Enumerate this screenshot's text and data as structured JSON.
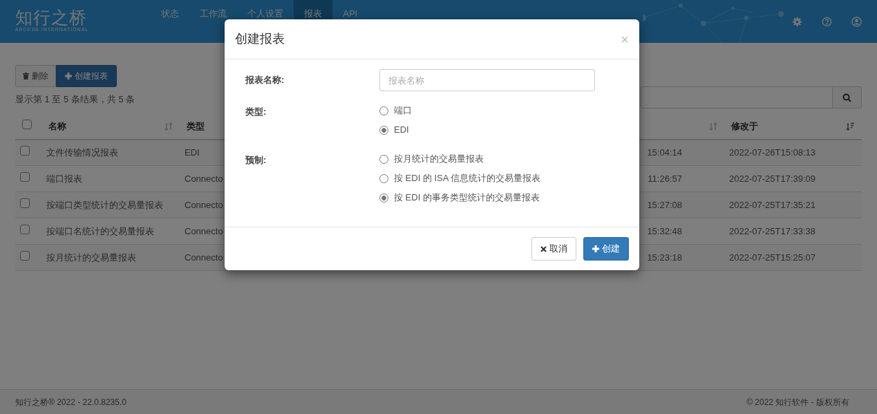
{
  "navbar": {
    "brand": "知行之桥",
    "brand_sub": "ARCESB INTERNATIONAL",
    "items": [
      {
        "label": "状态",
        "selected": false
      },
      {
        "label": "工作流",
        "selected": false
      },
      {
        "label": "个人设置",
        "selected": false
      },
      {
        "label": "报表",
        "selected": true
      },
      {
        "label": "API",
        "selected": false
      }
    ]
  },
  "toolbar": {
    "buttons": [
      {
        "label": "删除",
        "kind": "delete"
      },
      {
        "label": "创建报表",
        "kind": "create"
      }
    ],
    "summary": "显示第 1 至 5 条结果，共 5 条"
  },
  "table": {
    "all_checked": false,
    "columns": [
      {
        "label": "名称",
        "sortable": true,
        "sorted_desc": false
      },
      {
        "label": "类型"
      },
      {
        "sortable": true,
        "sorted_desc": false
      },
      {
        "label": "修改于",
        "sortable": true,
        "sorted_desc": true
      }
    ],
    "rows": [
      {
        "checked": false,
        "cells": [
          "文件传输情况报表",
          "EDI",
          "15:04:14",
          "2022-07-26T15:08:13"
        ]
      },
      {
        "checked": false,
        "cells": [
          "端口报表",
          "Connecto",
          "11:26:57",
          "2022-07-25T17:39:09"
        ]
      },
      {
        "checked": false,
        "cells": [
          "按端口类型统计的交易量报表",
          "Connecto",
          "15:27:08",
          "2022-07-25T17:35:21"
        ]
      },
      {
        "checked": false,
        "cells": [
          "按端口名统计的交易量报表",
          "Connecto",
          "15:32:48",
          "2022-07-25T17:33:38"
        ]
      },
      {
        "checked": false,
        "cells": [
          "按月统计的交易量报表",
          "Connecto",
          "15:23:18",
          "2022-07-25T15:25:07"
        ]
      }
    ]
  },
  "modal": {
    "title": "创建报表",
    "close": "×",
    "fields": [
      {
        "kind": "text",
        "label": "报表名称:",
        "placeholder": "报表名称"
      },
      {
        "kind": "radio",
        "label": "类型:",
        "options": [
          {
            "label": "端口",
            "selected": false
          },
          {
            "label": "EDI",
            "selected": true
          }
        ]
      },
      {
        "kind": "radio",
        "label": "预制:",
        "options": [
          {
            "label": "按月统计的交易量报表",
            "selected": false
          },
          {
            "label": "按 EDI 的 ISA 信息统计的交易量报表",
            "selected": false
          },
          {
            "label": "按 EDI 的事务类型统计的交易量报表",
            "selected": true
          }
        ]
      }
    ],
    "buttons": [
      {
        "label": "取消",
        "kind": "cancel"
      },
      {
        "label": "创建",
        "kind": "submit"
      }
    ]
  },
  "footer": {
    "left": "知行之桥® 2022 - 22.0.8235.0",
    "right": "© 2022 知行软件 - 版权所有"
  }
}
